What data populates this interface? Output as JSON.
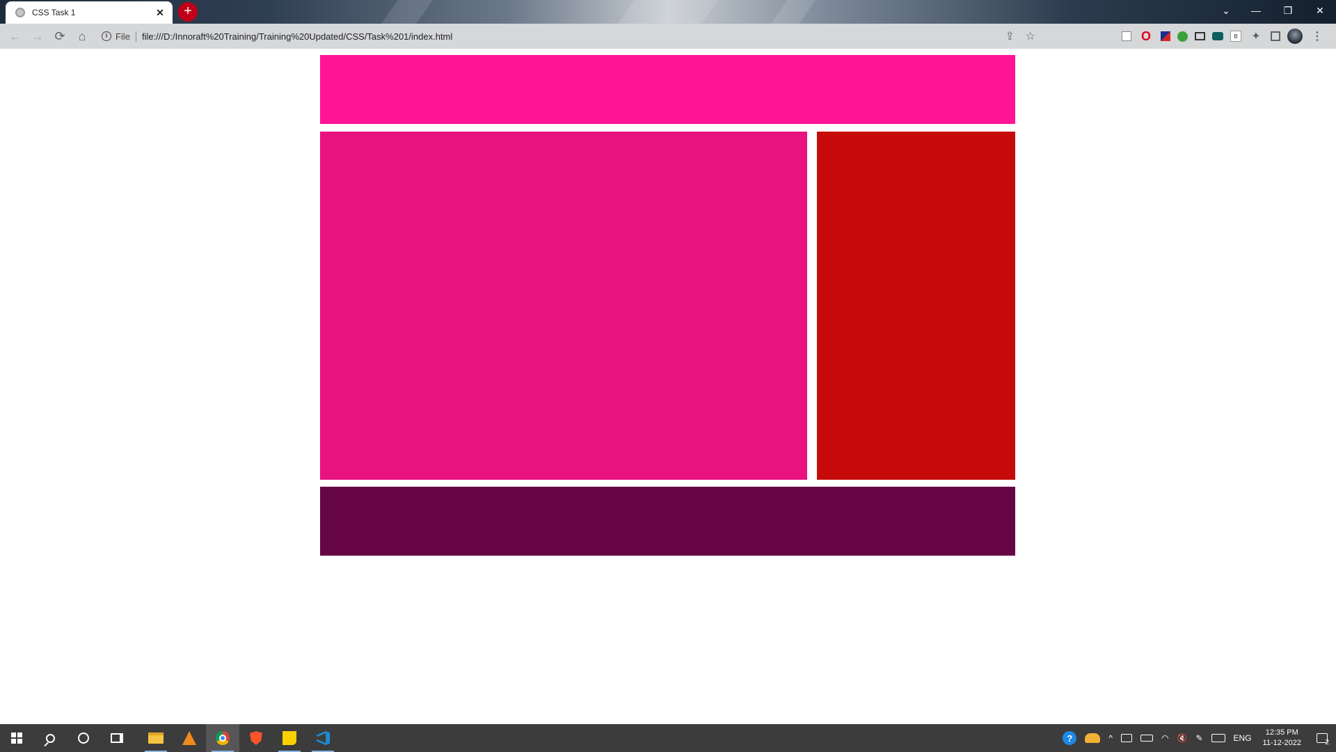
{
  "browser": {
    "tab_title": "CSS Task 1",
    "tab_close": "✕",
    "new_tab": "+",
    "address": {
      "scheme_label": "File",
      "url": "file:///D:/Innoraft%20Training/Training%20Updated/CSS/Task%201/index.html"
    },
    "nav": {
      "back": "←",
      "forward": "→",
      "reload": "⟳",
      "home": "⌂"
    },
    "window_controls": {
      "tab_search": "⌄",
      "minimize": "—",
      "restore": "❐",
      "close": "✕"
    },
    "extensions": {
      "opera": "O",
      "bookmark_b": "B",
      "puzzle": "✦",
      "menu": "⋮"
    }
  },
  "page": {
    "blocks": [
      {
        "role": "header",
        "color": "#ff1493"
      },
      {
        "role": "main",
        "color": "#e9137f"
      },
      {
        "role": "aside",
        "color": "#c70a0a"
      },
      {
        "role": "footer",
        "color": "#670644"
      }
    ]
  },
  "taskbar": {
    "apps": [
      "windows-start",
      "search",
      "cortana",
      "task-view",
      "file-explorer",
      "vlc",
      "chrome",
      "brave",
      "sticky-notes",
      "vscode"
    ],
    "tray": {
      "help": "?",
      "language": "ENG",
      "time": "12:35 PM",
      "date": "11-12-2022",
      "notification_count": "2",
      "chevron": "^",
      "volume": "🔇"
    }
  }
}
